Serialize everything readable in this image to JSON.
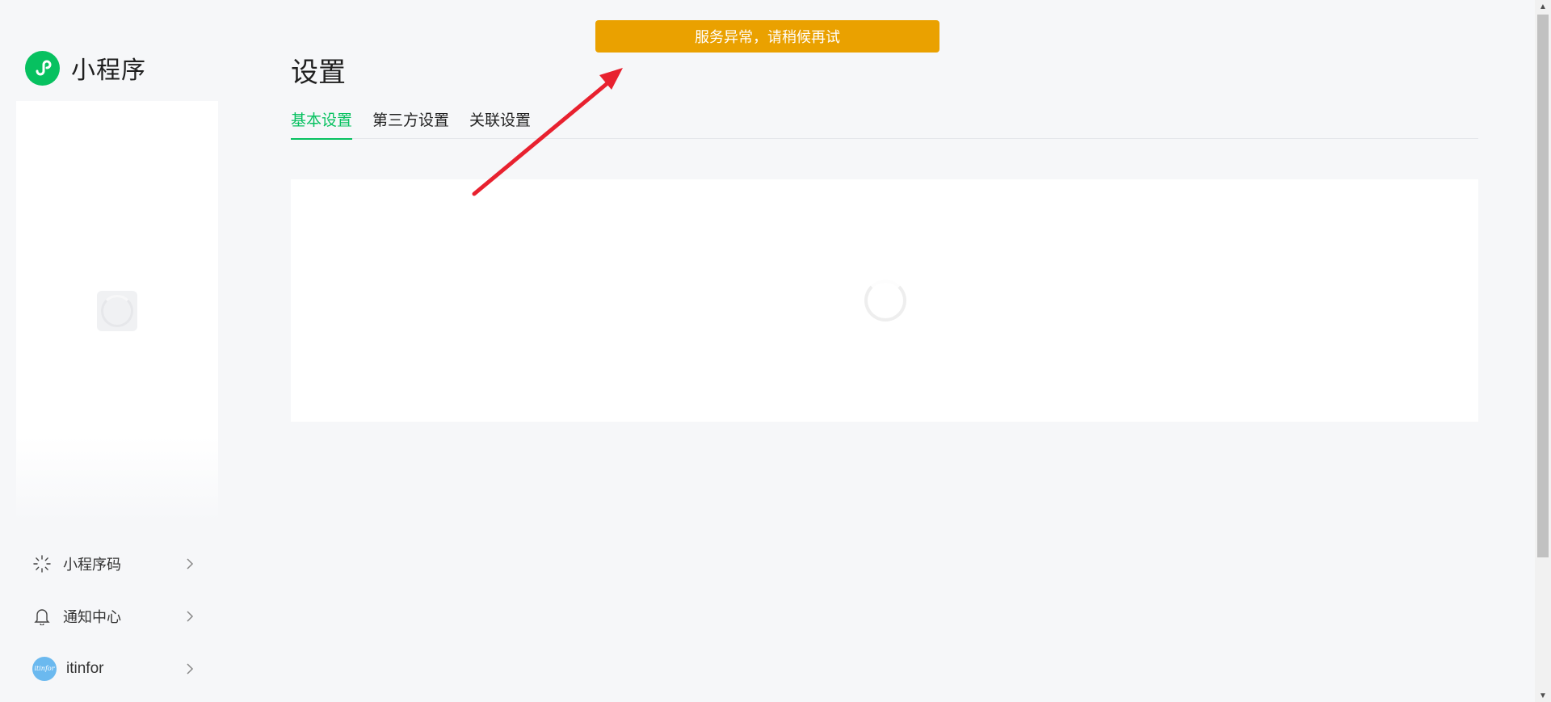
{
  "app": {
    "name": "小程序"
  },
  "sidebar": {
    "menu": [
      {
        "icon": "qrcode-icon",
        "label": "小程序码"
      },
      {
        "icon": "bell-icon",
        "label": "通知中心"
      }
    ],
    "user": {
      "name": "itinfor",
      "avatar_text": "itinfor"
    }
  },
  "main": {
    "title": "设置",
    "tabs": [
      {
        "label": "基本设置",
        "active": true
      },
      {
        "label": "第三方设置",
        "active": false
      },
      {
        "label": "关联设置",
        "active": false
      }
    ]
  },
  "toast": {
    "message": "服务异常，请稍候再试"
  },
  "colors": {
    "accent": "#07c160",
    "toast": "#eaa100",
    "annotation": "#e8212f"
  }
}
